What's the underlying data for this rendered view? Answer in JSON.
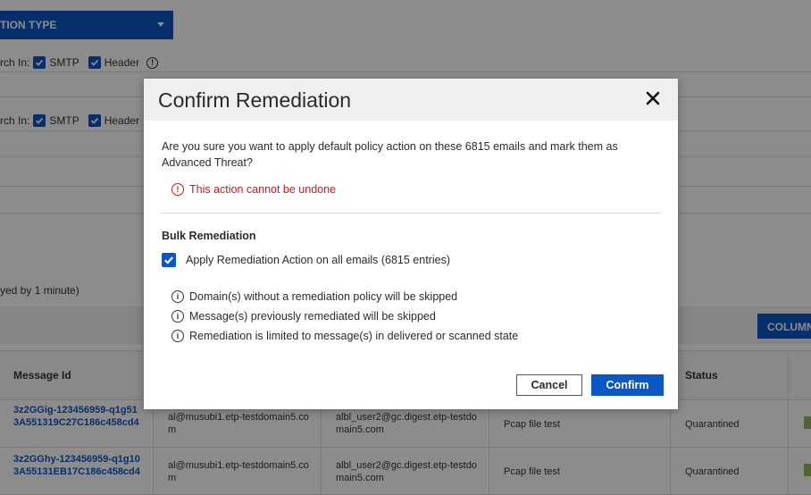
{
  "background": {
    "type_select": {
      "label": "TION TYPE"
    },
    "search_rows": [
      {
        "label": "rch In:",
        "options": [
          "SMTP",
          "Header"
        ]
      },
      {
        "label": "rch In:",
        "options": [
          "SMTP",
          "Header"
        ]
      }
    ],
    "hint": "yed by 1 minute)",
    "columns_button": "COLUMN",
    "table": {
      "headers": {
        "message_id": "Message Id",
        "status": "Status"
      },
      "rows": [
        {
          "message_id": "3z2GGig-123456959-q1g513A551319C27C186c458cd4",
          "sender": "al@musubi1.etp-testdomain5.com",
          "recipient": "albl_user2@gc.digest.etp-testdomain5.com",
          "subject": "Pcap file test",
          "status": "Quarantined"
        },
        {
          "message_id": "3z2GGhy-123456959-q1g103A55131EB17C186c458cd4",
          "sender": "al@musubi1.etp-testdomain5.com",
          "recipient": "albl_user2@gc.digest.etp-testdomain5.com",
          "subject": "Pcap file test",
          "status": "Quarantined"
        }
      ]
    }
  },
  "modal": {
    "title": "Confirm Remediation",
    "question": "Are you sure you want to apply default policy action on these 6815 emails and mark them as Advanced Threat?",
    "warning": "This action cannot be undone",
    "section_title": "Bulk Remediation",
    "bulk_checkbox": {
      "label": "Apply Remediation Action on all emails (6815 entries)",
      "checked": true
    },
    "notes": [
      "Domain(s) without a remediation policy will be skipped",
      "Message(s) previously remediated will be skipped",
      "Remediation is limited to message(s) in delivered or scanned state"
    ],
    "cancel_label": "Cancel",
    "confirm_label": "Confirm"
  },
  "colors": {
    "primary": "#0b57c4",
    "danger": "#d0181d",
    "header_bg": "#efefef"
  },
  "icons": {
    "close": "close-icon",
    "warning": "alert-circle-icon",
    "info": "info-icon",
    "check": "checkmark-icon"
  }
}
